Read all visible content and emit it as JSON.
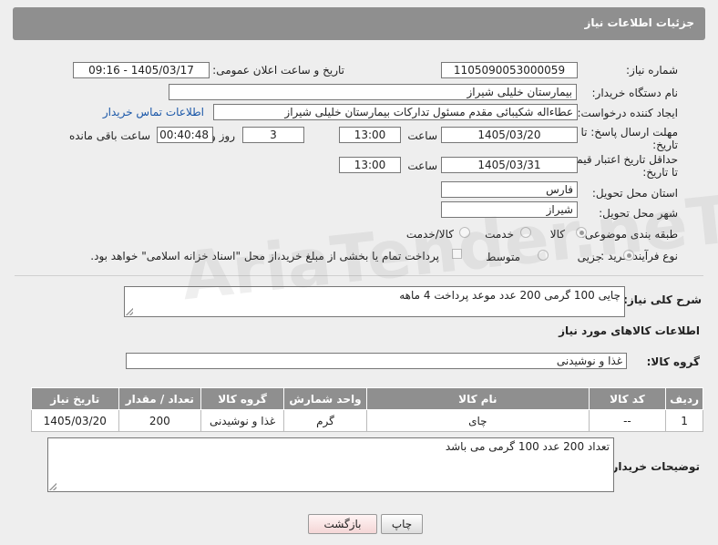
{
  "header": {
    "title": "جزئیات اطلاعات نیاز"
  },
  "fields": {
    "need_number_label": "شماره نیاز:",
    "need_number": "1105090053000059",
    "announce_label": "تاریخ و ساعت اعلان عمومی:",
    "announce_value": "1405/03/17 - 09:16",
    "buyer_org_label": "نام دستگاه خریدار:",
    "buyer_org": "بیمارستان خلیلی شیراز",
    "creator_label": "ایجاد کننده درخواست:",
    "creator": "عطاءاله شکیبائی مقدم مسئول تدارکات  بیمارستان خلیلی شیراز",
    "contact_link": "اطلاعات تماس خریدار",
    "deadline_label_1": "مهلت ارسال پاسخ: تا",
    "deadline_label_2": "تاریخ:",
    "deadline_date": "1405/03/20",
    "time_label": "ساعت",
    "deadline_time": "13:00",
    "days_value": "3",
    "days_label": "روز و",
    "remaining_time": "00:40:48",
    "remaining_label": "ساعت باقی مانده",
    "validity_label_1": "حداقل تاریخ اعتبار قیمت:",
    "validity_label_2": "تا تاریخ:",
    "validity_date": "1405/03/31",
    "validity_time": "13:00",
    "province_label": "استان محل تحویل:",
    "province": "فارس",
    "city_label": "شهر محل تحویل:",
    "city": "شیراز",
    "category_label": "طبقه بندی موضوعی:",
    "category_options": [
      "کالا",
      "خدمت",
      "کالا/خدمت"
    ],
    "process_label": "نوع فرآیند خرید :",
    "process_options": [
      "جزیی",
      "متوسط"
    ],
    "payment_note": "پرداخت تمام یا بخشی از مبلغ خرید،از محل \"اسناد خزانه اسلامی\" خواهد بود."
  },
  "description": {
    "label": "شرح کلی نیاز:",
    "value": "چایی 100 گرمی 200 عدد موعد پرداخت 4 ماهه"
  },
  "goods_section": {
    "title": "اطلاعات کالاهای مورد نیاز",
    "group_label": "گروه کالا:",
    "group_value": "غذا و نوشیدنی"
  },
  "table": {
    "headers": [
      "ردیف",
      "کد کالا",
      "نام کالا",
      "واحد شمارش",
      "گروه کالا",
      "تعداد / مقدار",
      "تاریخ نیاز"
    ],
    "rows": [
      [
        "1",
        "--",
        "چای",
        "گرم",
        "غذا و نوشیدنی",
        "200",
        "1405/03/20"
      ]
    ]
  },
  "buyer_notes": {
    "label": "توضیحات خریدار:",
    "value": "تعداد 200 عدد 100 گرمی می باشد"
  },
  "buttons": {
    "print": "چاپ",
    "back": "بازگشت"
  },
  "watermark": "AriaTender.neT"
}
